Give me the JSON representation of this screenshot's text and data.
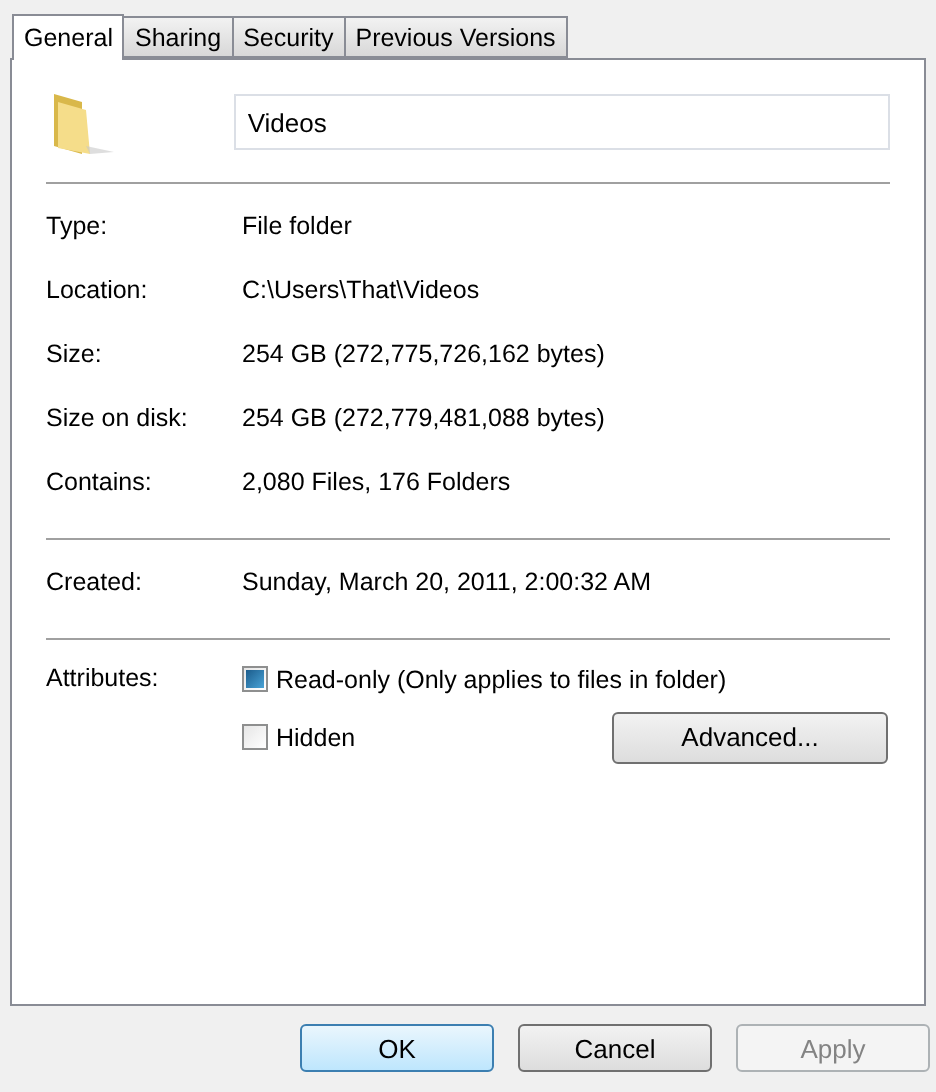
{
  "tabs": [
    {
      "label": "General",
      "selected": true
    },
    {
      "label": "Sharing",
      "selected": false
    },
    {
      "label": "Security",
      "selected": false
    },
    {
      "label": "Previous Versions",
      "selected": false
    }
  ],
  "name_field": {
    "value": "Videos"
  },
  "info_groups": [
    [
      {
        "label": "Type:",
        "value": "File folder"
      },
      {
        "label": "Location:",
        "value": "C:\\Users\\That\\Videos"
      },
      {
        "label": "Size:",
        "value": "254 GB (272,775,726,162 bytes)"
      },
      {
        "label": "Size on disk:",
        "value": "254 GB (272,779,481,088 bytes)"
      },
      {
        "label": "Contains:",
        "value": "2,080 Files, 176 Folders"
      }
    ],
    [
      {
        "label": "Created:",
        "value": "Sunday, March 20, 2011, 2:00:32 AM"
      }
    ]
  ],
  "attributes": {
    "label": "Attributes:",
    "items": [
      {
        "label": "Read-only (Only applies to files in folder)",
        "checked": false,
        "indeterminate": true
      },
      {
        "label": "Hidden",
        "checked": false,
        "indeterminate": false
      }
    ],
    "advanced_button": "Advanced..."
  },
  "buttons": [
    {
      "label": "OK",
      "default": true,
      "disabled": false
    },
    {
      "label": "Cancel",
      "default": false,
      "disabled": false
    },
    {
      "label": "Apply",
      "default": false,
      "disabled": true
    }
  ]
}
